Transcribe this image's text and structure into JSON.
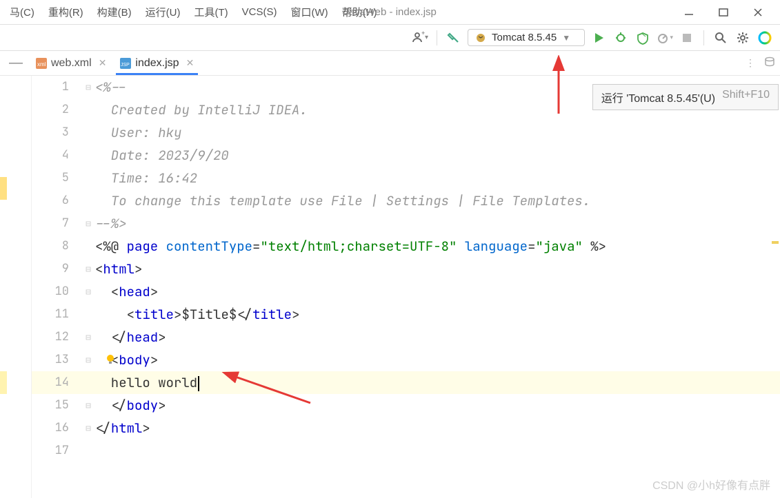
{
  "menu": {
    "items": [
      {
        "label": "马(C)"
      },
      {
        "label": "重构(R)"
      },
      {
        "label": "构建(B)"
      },
      {
        "label": "运行(U)"
      },
      {
        "label": "工具(T)"
      },
      {
        "label": "VCS(S)"
      },
      {
        "label": "窗口(W)"
      },
      {
        "label": "帮助(H)"
      }
    ],
    "title": "JavaWeb - index.jsp"
  },
  "toolbar": {
    "run_config": "Tomcat 8.5.45"
  },
  "tabs": [
    {
      "name": "web.xml",
      "active": false
    },
    {
      "name": "index.jsp",
      "active": true
    }
  ],
  "tooltip": {
    "text": "运行 'Tomcat 8.5.45'(U)",
    "shortcut": "Shift+F10"
  },
  "editor": {
    "lines": [
      {
        "n": 1,
        "seg": [
          {
            "t": "<%--",
            "c": "c-comment"
          }
        ]
      },
      {
        "n": 2,
        "seg": [
          {
            "t": "  Created by IntelliJ IDEA.",
            "c": "c-comment"
          }
        ]
      },
      {
        "n": 3,
        "seg": [
          {
            "t": "  User: hky",
            "c": "c-comment"
          }
        ]
      },
      {
        "n": 4,
        "seg": [
          {
            "t": "  Date: 2023/9/20",
            "c": "c-comment"
          }
        ]
      },
      {
        "n": 5,
        "seg": [
          {
            "t": "  Time: 16:42",
            "c": "c-comment"
          }
        ]
      },
      {
        "n": 6,
        "seg": [
          {
            "t": "  To change this template use File | Settings | File Templates.",
            "c": "c-comment"
          }
        ]
      },
      {
        "n": 7,
        "seg": [
          {
            "t": "--%>",
            "c": "c-comment"
          }
        ]
      },
      {
        "n": 8,
        "seg": [
          {
            "t": "<%@ ",
            "c": "c-delim"
          },
          {
            "t": "page ",
            "c": "c-keyword"
          },
          {
            "t": "contentType",
            "c": "c-attr"
          },
          {
            "t": "=",
            "c": "c-delim"
          },
          {
            "t": "\"text/html;charset=UTF-8\"",
            "c": "c-str"
          },
          {
            "t": " language",
            "c": "c-attr"
          },
          {
            "t": "=",
            "c": "c-delim"
          },
          {
            "t": "\"java\"",
            "c": "c-str"
          },
          {
            "t": " %>",
            "c": "c-delim"
          }
        ]
      },
      {
        "n": 9,
        "seg": [
          {
            "t": "<",
            "c": "c-delim"
          },
          {
            "t": "html",
            "c": "c-keyword"
          },
          {
            "t": ">",
            "c": "c-delim"
          }
        ]
      },
      {
        "n": 10,
        "seg": [
          {
            "t": "  <",
            "c": "c-delim"
          },
          {
            "t": "head",
            "c": "c-keyword"
          },
          {
            "t": ">",
            "c": "c-delim"
          }
        ]
      },
      {
        "n": 11,
        "seg": [
          {
            "t": "    <",
            "c": "c-delim"
          },
          {
            "t": "title",
            "c": "c-keyword"
          },
          {
            "t": ">",
            "c": "c-delim"
          },
          {
            "t": "$Title$",
            "c": "c-text"
          },
          {
            "t": "</",
            "c": "c-delim"
          },
          {
            "t": "title",
            "c": "c-keyword"
          },
          {
            "t": ">",
            "c": "c-delim"
          }
        ]
      },
      {
        "n": 12,
        "seg": [
          {
            "t": "  </",
            "c": "c-delim"
          },
          {
            "t": "head",
            "c": "c-keyword"
          },
          {
            "t": ">",
            "c": "c-delim"
          }
        ]
      },
      {
        "n": 13,
        "seg": [
          {
            "t": "  <",
            "c": "c-delim"
          },
          {
            "t": "body",
            "c": "c-keyword"
          },
          {
            "t": ">",
            "c": "c-delim"
          }
        ]
      },
      {
        "n": 14,
        "seg": [
          {
            "t": "  hello world",
            "c": "c-text"
          }
        ],
        "caret": true,
        "hl": true
      },
      {
        "n": 15,
        "seg": [
          {
            "t": "  </",
            "c": "c-delim"
          },
          {
            "t": "body",
            "c": "c-keyword"
          },
          {
            "t": ">",
            "c": "c-delim"
          }
        ]
      },
      {
        "n": 16,
        "seg": [
          {
            "t": "</",
            "c": "c-delim"
          },
          {
            "t": "html",
            "c": "c-keyword"
          },
          {
            "t": ">",
            "c": "c-delim"
          }
        ]
      },
      {
        "n": 17,
        "seg": []
      }
    ]
  },
  "watermark": "CSDN @小h好像有点胖"
}
